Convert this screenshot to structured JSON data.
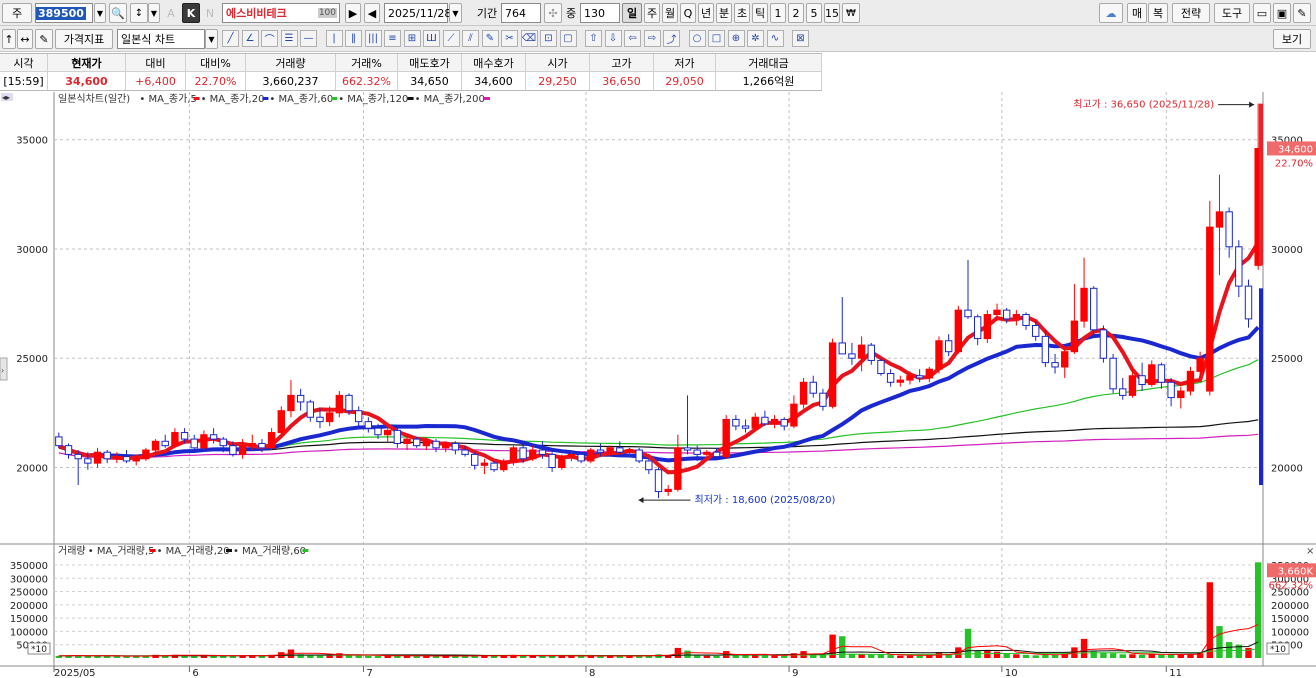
{
  "toolbar1": {
    "type_label": "주",
    "stock_code": "389500",
    "k_label": "K",
    "n_label": "N",
    "stock_name": "에스비비테크",
    "flag_value": "100",
    "date": "2025/11/28",
    "period_label": "기간",
    "period_value": "764",
    "mid_label": "중",
    "mid_value": "130",
    "intervals": [
      "일",
      "주",
      "월",
      "Q",
      "년",
      "분",
      "초",
      "틱",
      "1",
      "2",
      "5",
      "15"
    ],
    "right_buttons": [
      "매",
      "복",
      "전략",
      "도구"
    ]
  },
  "toolbar2": {
    "indicator_button": "가격지표",
    "chart_type": "일본식 차트",
    "view_button": "보기"
  },
  "quote": {
    "headers": [
      "시각",
      "현재가",
      "대비",
      "대비%",
      "거래량",
      "거래%",
      "매도호가",
      "매수호가",
      "시가",
      "고가",
      "저가",
      "거래대금"
    ],
    "values": [
      "[15:59]",
      "34,600",
      "+6,400",
      "22.70%",
      "3,660,237",
      "662.32%",
      "34,650",
      "34,600",
      "29,250",
      "36,650",
      "29,050",
      "1,266억원"
    ]
  },
  "colors": {
    "up": "#ff0000",
    "down": "#1a28c8",
    "ma5": "#e8141c",
    "ma20": "#1a28d0",
    "ma60": "#27c227",
    "ma120": "#111111",
    "ma200": "#d020c0",
    "vol_up": "#ff0000",
    "vol_down": "#27c227"
  },
  "price_legend": {
    "title": "일본식차트(일간)",
    "items": [
      "MA_종가,5",
      "MA_종가,20",
      "MA_종가,60",
      "MA_종가,120",
      "MA_종가,200"
    ]
  },
  "volume_legend": {
    "title": "거래량",
    "items": [
      "MA_거래량,5",
      "MA_거래량,20",
      "MA_거래량,60"
    ]
  },
  "annotations": {
    "high": "최고가 : 36,650 (2025/11/28)",
    "low": "최저가 : 18,600 (2025/08/20)",
    "price_tag": "34,600",
    "price_pct": "22.70%",
    "vol_tag": "3,660K",
    "vol_pct": "662.32%",
    "x10": "*10"
  },
  "chart_data": {
    "type": "candlestick",
    "price_ylim": [
      16500,
      37000
    ],
    "price_ticks": [
      20000,
      25000,
      30000,
      35000
    ],
    "volume_ylim": [
      0,
      380000
    ],
    "volume_ticks": [
      50000,
      100000,
      150000,
      200000,
      250000,
      300000,
      350000
    ],
    "x_labels": [
      {
        "label": "2025/05",
        "day": 0
      },
      {
        "label": "6",
        "day": 14
      },
      {
        "label": "7",
        "day": 32
      },
      {
        "label": "8",
        "day": 55
      },
      {
        "label": "9",
        "day": 76
      },
      {
        "label": "10",
        "day": 98
      },
      {
        "label": "11",
        "day": 115
      }
    ],
    "candles": [
      {
        "o": 21400,
        "h": 21600,
        "l": 20900,
        "c": 21000
      },
      {
        "o": 21000,
        "h": 21100,
        "l": 20400,
        "c": 20600
      },
      {
        "o": 20600,
        "h": 20800,
        "l": 19200,
        "c": 20400
      },
      {
        "o": 20400,
        "h": 20700,
        "l": 19900,
        "c": 20200
      },
      {
        "o": 20200,
        "h": 20900,
        "l": 20000,
        "c": 20700
      },
      {
        "o": 20700,
        "h": 20800,
        "l": 20200,
        "c": 20400
      },
      {
        "o": 20400,
        "h": 20700,
        "l": 20200,
        "c": 20500
      },
      {
        "o": 20500,
        "h": 20800,
        "l": 20200,
        "c": 20300
      },
      {
        "o": 20300,
        "h": 20600,
        "l": 20100,
        "c": 20400
      },
      {
        "o": 20400,
        "h": 20900,
        "l": 20300,
        "c": 20800
      },
      {
        "o": 20800,
        "h": 21300,
        "l": 20600,
        "c": 21200
      },
      {
        "o": 21200,
        "h": 21500,
        "l": 20900,
        "c": 21000
      },
      {
        "o": 21000,
        "h": 21800,
        "l": 20900,
        "c": 21600
      },
      {
        "o": 21600,
        "h": 21800,
        "l": 21100,
        "c": 21300
      },
      {
        "o": 21300,
        "h": 21500,
        "l": 20700,
        "c": 20900
      },
      {
        "o": 20900,
        "h": 21700,
        "l": 20800,
        "c": 21500
      },
      {
        "o": 21500,
        "h": 21800,
        "l": 21100,
        "c": 21300
      },
      {
        "o": 21300,
        "h": 21400,
        "l": 20700,
        "c": 21000
      },
      {
        "o": 21000,
        "h": 21200,
        "l": 20500,
        "c": 20600
      },
      {
        "o": 20600,
        "h": 21300,
        "l": 20400,
        "c": 21000
      },
      {
        "o": 21000,
        "h": 21500,
        "l": 20800,
        "c": 21100
      },
      {
        "o": 21100,
        "h": 21300,
        "l": 20700,
        "c": 20900
      },
      {
        "o": 20900,
        "h": 21800,
        "l": 20800,
        "c": 21600
      },
      {
        "o": 21600,
        "h": 22800,
        "l": 21400,
        "c": 22600
      },
      {
        "o": 22600,
        "h": 24000,
        "l": 22300,
        "c": 23300
      },
      {
        "o": 23300,
        "h": 23600,
        "l": 22600,
        "c": 23000
      },
      {
        "o": 23000,
        "h": 23100,
        "l": 22100,
        "c": 22300
      },
      {
        "o": 22300,
        "h": 22700,
        "l": 21800,
        "c": 22100
      },
      {
        "o": 22100,
        "h": 22800,
        "l": 21900,
        "c": 22500
      },
      {
        "o": 22500,
        "h": 23500,
        "l": 22300,
        "c": 23300
      },
      {
        "o": 23300,
        "h": 23400,
        "l": 22400,
        "c": 22600
      },
      {
        "o": 22600,
        "h": 22800,
        "l": 21900,
        "c": 22100
      },
      {
        "o": 22100,
        "h": 22300,
        "l": 21600,
        "c": 21800
      },
      {
        "o": 21800,
        "h": 22000,
        "l": 21300,
        "c": 21500
      },
      {
        "o": 21500,
        "h": 21900,
        "l": 21200,
        "c": 21700
      },
      {
        "o": 21700,
        "h": 21800,
        "l": 20900,
        "c": 21100
      },
      {
        "o": 21100,
        "h": 21500,
        "l": 20800,
        "c": 21300
      },
      {
        "o": 21300,
        "h": 21400,
        "l": 20900,
        "c": 21000
      },
      {
        "o": 21000,
        "h": 21300,
        "l": 20800,
        "c": 21200
      },
      {
        "o": 21200,
        "h": 21300,
        "l": 20700,
        "c": 20900
      },
      {
        "o": 20900,
        "h": 21200,
        "l": 20700,
        "c": 21100
      },
      {
        "o": 21100,
        "h": 21200,
        "l": 20600,
        "c": 20800
      },
      {
        "o": 20800,
        "h": 21000,
        "l": 20500,
        "c": 20600
      },
      {
        "o": 20600,
        "h": 20700,
        "l": 19900,
        "c": 20100
      },
      {
        "o": 20100,
        "h": 20400,
        "l": 19700,
        "c": 20200
      },
      {
        "o": 20200,
        "h": 20300,
        "l": 19800,
        "c": 19900
      },
      {
        "o": 19900,
        "h": 20400,
        "l": 19800,
        "c": 20300
      },
      {
        "o": 20300,
        "h": 21000,
        "l": 20100,
        "c": 20900
      },
      {
        "o": 20900,
        "h": 21100,
        "l": 20200,
        "c": 20400
      },
      {
        "o": 20400,
        "h": 21000,
        "l": 20300,
        "c": 20800
      },
      {
        "o": 20800,
        "h": 21200,
        "l": 20400,
        "c": 20600
      },
      {
        "o": 20600,
        "h": 20700,
        "l": 19800,
        "c": 20000
      },
      {
        "o": 20000,
        "h": 20600,
        "l": 19900,
        "c": 20500
      },
      {
        "o": 20500,
        "h": 20800,
        "l": 20300,
        "c": 20600
      },
      {
        "o": 20600,
        "h": 20700,
        "l": 20200,
        "c": 20300
      },
      {
        "o": 20300,
        "h": 20900,
        "l": 20200,
        "c": 20800
      },
      {
        "o": 20800,
        "h": 21100,
        "l": 20500,
        "c": 20700
      },
      {
        "o": 20700,
        "h": 21000,
        "l": 20500,
        "c": 20900
      },
      {
        "o": 20900,
        "h": 21200,
        "l": 20600,
        "c": 20700
      },
      {
        "o": 20700,
        "h": 20900,
        "l": 20500,
        "c": 20800
      },
      {
        "o": 20800,
        "h": 20900,
        "l": 20200,
        "c": 20300
      },
      {
        "o": 20300,
        "h": 20400,
        "l": 19700,
        "c": 19900
      },
      {
        "o": 19900,
        "h": 20000,
        "l": 18600,
        "c": 18900
      },
      {
        "o": 18900,
        "h": 19200,
        "l": 18700,
        "c": 19000
      },
      {
        "o": 19000,
        "h": 21500,
        "l": 18900,
        "c": 20900
      },
      {
        "o": 20900,
        "h": 23300,
        "l": 20600,
        "c": 20800
      },
      {
        "o": 20800,
        "h": 21000,
        "l": 20300,
        "c": 20600
      },
      {
        "o": 20600,
        "h": 20800,
        "l": 20300,
        "c": 20700
      },
      {
        "o": 20700,
        "h": 20900,
        "l": 20400,
        "c": 20500
      },
      {
        "o": 20500,
        "h": 22400,
        "l": 20400,
        "c": 22200
      },
      {
        "o": 22200,
        "h": 22400,
        "l": 21700,
        "c": 21900
      },
      {
        "o": 21900,
        "h": 22200,
        "l": 21600,
        "c": 21800
      },
      {
        "o": 21800,
        "h": 22500,
        "l": 21700,
        "c": 22300
      },
      {
        "o": 22300,
        "h": 22600,
        "l": 21900,
        "c": 22000
      },
      {
        "o": 22000,
        "h": 22400,
        "l": 21800,
        "c": 22200
      },
      {
        "o": 22200,
        "h": 22300,
        "l": 21700,
        "c": 21900
      },
      {
        "o": 21900,
        "h": 23300,
        "l": 21800,
        "c": 22900
      },
      {
        "o": 22900,
        "h": 24100,
        "l": 22700,
        "c": 23900
      },
      {
        "o": 23900,
        "h": 24200,
        "l": 23200,
        "c": 23400
      },
      {
        "o": 23400,
        "h": 23600,
        "l": 22600,
        "c": 22800
      },
      {
        "o": 22800,
        "h": 25900,
        "l": 22700,
        "c": 25700
      },
      {
        "o": 25700,
        "h": 27800,
        "l": 25200,
        "c": 25200
      },
      {
        "o": 25200,
        "h": 25700,
        "l": 24700,
        "c": 25000
      },
      {
        "o": 25000,
        "h": 26000,
        "l": 24400,
        "c": 25600
      },
      {
        "o": 25600,
        "h": 25700,
        "l": 24700,
        "c": 24900
      },
      {
        "o": 24900,
        "h": 25000,
        "l": 24200,
        "c": 24300
      },
      {
        "o": 24300,
        "h": 24500,
        "l": 23700,
        "c": 23900
      },
      {
        "o": 23900,
        "h": 24200,
        "l": 23700,
        "c": 24000
      },
      {
        "o": 24000,
        "h": 24400,
        "l": 23800,
        "c": 24200
      },
      {
        "o": 24200,
        "h": 24500,
        "l": 23900,
        "c": 24100
      },
      {
        "o": 24100,
        "h": 24600,
        "l": 23900,
        "c": 24500
      },
      {
        "o": 24500,
        "h": 26000,
        "l": 24300,
        "c": 25800
      },
      {
        "o": 25800,
        "h": 26100,
        "l": 25100,
        "c": 25300
      },
      {
        "o": 25300,
        "h": 27400,
        "l": 25200,
        "c": 27200
      },
      {
        "o": 27200,
        "h": 29500,
        "l": 26800,
        "c": 26900
      },
      {
        "o": 26900,
        "h": 27000,
        "l": 25600,
        "c": 25900
      },
      {
        "o": 25900,
        "h": 27200,
        "l": 25700,
        "c": 27000
      },
      {
        "o": 27000,
        "h": 27500,
        "l": 26700,
        "c": 27200
      },
      {
        "o": 27200,
        "h": 27300,
        "l": 26600,
        "c": 26800
      },
      {
        "o": 26800,
        "h": 27200,
        "l": 26500,
        "c": 27000
      },
      {
        "o": 27000,
        "h": 27100,
        "l": 26300,
        "c": 26500
      },
      {
        "o": 26500,
        "h": 26700,
        "l": 25800,
        "c": 26000
      },
      {
        "o": 26000,
        "h": 26300,
        "l": 24600,
        "c": 24800
      },
      {
        "o": 24800,
        "h": 25200,
        "l": 24300,
        "c": 24600
      },
      {
        "o": 24600,
        "h": 25500,
        "l": 24100,
        "c": 25300
      },
      {
        "o": 25300,
        "h": 28400,
        "l": 25200,
        "c": 26700
      },
      {
        "o": 26700,
        "h": 29600,
        "l": 26400,
        "c": 28200
      },
      {
        "o": 28200,
        "h": 28300,
        "l": 26100,
        "c": 26300
      },
      {
        "o": 26300,
        "h": 26500,
        "l": 24800,
        "c": 25000
      },
      {
        "o": 25000,
        "h": 25200,
        "l": 23400,
        "c": 23600
      },
      {
        "o": 23600,
        "h": 24100,
        "l": 23100,
        "c": 23300
      },
      {
        "o": 23300,
        "h": 24600,
        "l": 23200,
        "c": 24200
      },
      {
        "o": 24200,
        "h": 24800,
        "l": 23500,
        "c": 23800
      },
      {
        "o": 23800,
        "h": 24900,
        "l": 23700,
        "c": 24700
      },
      {
        "o": 24700,
        "h": 24800,
        "l": 23600,
        "c": 23900
      },
      {
        "o": 23900,
        "h": 24100,
        "l": 22800,
        "c": 23200
      },
      {
        "o": 23200,
        "h": 23700,
        "l": 22700,
        "c": 23500
      },
      {
        "o": 23500,
        "h": 24600,
        "l": 23300,
        "c": 24400
      },
      {
        "o": 24400,
        "h": 25300,
        "l": 24100,
        "c": 25000
      },
      {
        "o": 23500,
        "h": 32200,
        "l": 23300,
        "c": 31000
      },
      {
        "o": 31000,
        "h": 33400,
        "l": 28800,
        "c": 31700
      },
      {
        "o": 31700,
        "h": 31900,
        "l": 29600,
        "c": 30100
      },
      {
        "o": 30100,
        "h": 30400,
        "l": 27800,
        "c": 28300
      },
      {
        "o": 28300,
        "h": 28600,
        "l": 26400,
        "c": 26800
      },
      {
        "o": 29250,
        "h": 36650,
        "l": 29050,
        "c": 34600
      }
    ],
    "volumes": [
      8000,
      9000,
      10000,
      7000,
      9000,
      8000,
      6000,
      6000,
      7000,
      9000,
      12000,
      10000,
      12000,
      9000,
      8000,
      11000,
      9000,
      8000,
      8000,
      9000,
      10000,
      8000,
      12000,
      22000,
      32000,
      14000,
      10000,
      9000,
      11000,
      18000,
      10000,
      9000,
      8000,
      8000,
      9000,
      8000,
      8000,
      7000,
      8000,
      7000,
      8000,
      7000,
      8000,
      10000,
      8000,
      9000,
      8000,
      12000,
      9000,
      9000,
      8000,
      9000,
      8000,
      7000,
      7000,
      8000,
      8000,
      7000,
      8000,
      7000,
      8000,
      11000,
      14000,
      9000,
      38000,
      28000,
      10000,
      9000,
      8000,
      26000,
      12000,
      10000,
      12000,
      9000,
      10000,
      9000,
      18000,
      26000,
      14000,
      12000,
      88000,
      82000,
      16000,
      15000,
      12000,
      13000,
      11000,
      9000,
      9000,
      9000,
      10000,
      22000,
      14000,
      40000,
      110000,
      28000,
      30000,
      24000,
      16000,
      14000,
      12000,
      10000,
      14000,
      12000,
      16000,
      40000,
      72000,
      24000,
      20000,
      18000,
      14000,
      14000,
      12000,
      16000,
      12000,
      14000,
      12000,
      14000,
      18000,
      285000,
      120000,
      60000,
      50000,
      38000,
      360000
    ],
    "volume_colors": [
      "g",
      "g",
      "g",
      "g",
      "g",
      "g",
      "g",
      "g",
      "g",
      "g",
      "r",
      "g",
      "r",
      "g",
      "g",
      "r",
      "g",
      "g",
      "g",
      "r",
      "r",
      "g",
      "r",
      "r",
      "r",
      "g",
      "g",
      "g",
      "r",
      "r",
      "g",
      "g",
      "g",
      "g",
      "r",
      "g",
      "r",
      "g",
      "r",
      "g",
      "r",
      "g",
      "g",
      "g",
      "r",
      "g",
      "r",
      "r",
      "g",
      "r",
      "g",
      "g",
      "r",
      "r",
      "g",
      "r",
      "g",
      "r",
      "g",
      "r",
      "g",
      "g",
      "g",
      "r",
      "r",
      "g",
      "g",
      "r",
      "g",
      "r",
      "g",
      "g",
      "r",
      "g",
      "r",
      "g",
      "r",
      "r",
      "g",
      "g",
      "r",
      "g",
      "g",
      "r",
      "g",
      "g",
      "g",
      "r",
      "r",
      "g",
      "r",
      "r",
      "g",
      "r",
      "g",
      "g",
      "r",
      "r",
      "g",
      "r",
      "g",
      "g",
      "g",
      "g",
      "r",
      "r",
      "r",
      "g",
      "g",
      "g",
      "g",
      "r",
      "g",
      "r",
      "g",
      "g",
      "r",
      "r",
      "r",
      "r",
      "g",
      "g",
      "g",
      "r"
    ]
  }
}
